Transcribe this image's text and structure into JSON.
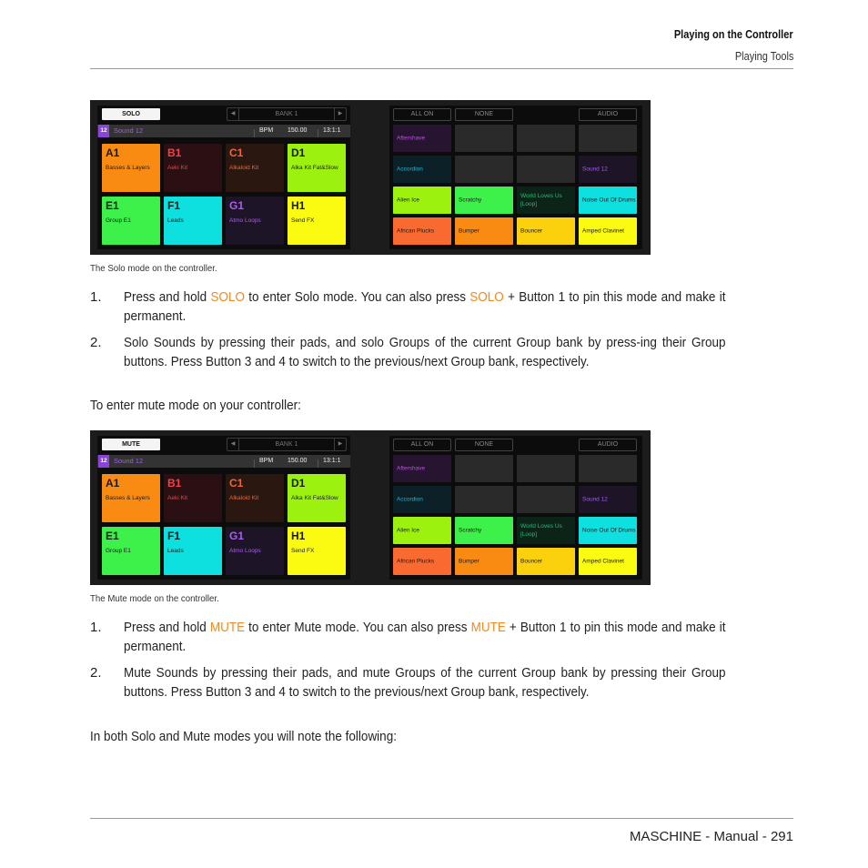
{
  "header": {
    "chapter": "Playing on the Controller",
    "section": "Playing Tools"
  },
  "figures": [
    {
      "mode_label": "SOLO",
      "caption": "The Solo mode on the controller.",
      "bank": {
        "label": "BANK 1",
        "prev_icon": "arrow-left-icon",
        "next_icon": "arrow-right-icon"
      },
      "status": {
        "sound_number": "12",
        "sound_name": "Sound 12",
        "bpm_label": "BPM",
        "bpm_value": "150.00",
        "position": "13:1:1"
      },
      "groups": [
        {
          "id": "A1",
          "name": "Basses & Layers",
          "bg": "#f98b13",
          "fg": "#1a1a1a"
        },
        {
          "id": "B1",
          "name": "Aeki Kit",
          "bg": "#2a1012",
          "fg": "#f0424a"
        },
        {
          "id": "C1",
          "name": "Alkaloid Kit",
          "bg": "#2a1710",
          "fg": "#f0643a"
        },
        {
          "id": "D1",
          "name": "Alka Kit Fat&Slow",
          "bg": "#9cf20e",
          "fg": "#1a1a1a"
        },
        {
          "id": "E1",
          "name": "Group E1",
          "bg": "#3ef14a",
          "fg": "#1a1a1a"
        },
        {
          "id": "F1",
          "name": "Leads",
          "bg": "#0ee0df",
          "fg": "#1a1a1a"
        },
        {
          "id": "G1",
          "name": "Atmo Loops",
          "bg": "#1e1428",
          "fg": "#a85ef0"
        },
        {
          "id": "H1",
          "name": "Send FX",
          "bg": "#fbfb12",
          "fg": "#1a1a1a"
        }
      ],
      "top_buttons": {
        "all_on": "ALL ON",
        "none": "NONE",
        "audio": "AUDIO"
      },
      "sounds": [
        {
          "name": "Aftershave",
          "bg": "#261430",
          "fg": "#c04ee8"
        },
        {
          "name": "",
          "bg": "#2a2a2a",
          "fg": "#888"
        },
        {
          "name": "",
          "bg": "#2a2a2a",
          "fg": "#888"
        },
        {
          "name": "",
          "bg": "#2a2a2a",
          "fg": "#888"
        },
        {
          "name": "Accordion",
          "bg": "#0c2028",
          "fg": "#18b8e0"
        },
        {
          "name": "",
          "bg": "#2a2a2a",
          "fg": "#888"
        },
        {
          "name": "",
          "bg": "#2a2a2a",
          "fg": "#888"
        },
        {
          "name": "Sound 12",
          "bg": "#1e1428",
          "fg": "#a25ee8"
        },
        {
          "name": "Alien Ice",
          "bg": "#9cf20e",
          "fg": "#1a1a1a"
        },
        {
          "name": "Scratchy",
          "bg": "#3ef14a",
          "fg": "#1a1a1a"
        },
        {
          "name": "World Loves Us [Loop]",
          "bg": "#0c2418",
          "fg": "#2cb878"
        },
        {
          "name": "Noise Out Of Drums",
          "bg": "#0ee0df",
          "fg": "#1a1a1a"
        },
        {
          "name": "African Plucks",
          "bg": "#f96a30",
          "fg": "#1a1a1a"
        },
        {
          "name": "Bumper",
          "bg": "#f98b13",
          "fg": "#1a1a1a"
        },
        {
          "name": "Bouncer",
          "bg": "#fbd10e",
          "fg": "#1a1a1a"
        },
        {
          "name": "Amped Clavinet",
          "bg": "#fbfb12",
          "fg": "#1a1a1a"
        }
      ]
    },
    {
      "mode_label": "MUTE",
      "caption": "The Mute mode on the controller.",
      "bank": {
        "label": "BANK 1",
        "prev_icon": "arrow-left-icon",
        "next_icon": "arrow-right-icon"
      },
      "status": {
        "sound_number": "12",
        "sound_name": "Sound 12",
        "bpm_label": "BPM",
        "bpm_value": "150.00",
        "position": "13:1:1"
      },
      "groups": [
        {
          "id": "A1",
          "name": "Basses & Layers",
          "bg": "#f98b13",
          "fg": "#1a1a1a"
        },
        {
          "id": "B1",
          "name": "Aeki Kit",
          "bg": "#2a1012",
          "fg": "#f0424a"
        },
        {
          "id": "C1",
          "name": "Alkaloid Kit",
          "bg": "#2a1710",
          "fg": "#f0643a"
        },
        {
          "id": "D1",
          "name": "Alka Kit Fat&Slow",
          "bg": "#9cf20e",
          "fg": "#1a1a1a"
        },
        {
          "id": "E1",
          "name": "Group E1",
          "bg": "#3ef14a",
          "fg": "#1a1a1a"
        },
        {
          "id": "F1",
          "name": "Leads",
          "bg": "#0ee0df",
          "fg": "#1a1a1a"
        },
        {
          "id": "G1",
          "name": "Atmo Loops",
          "bg": "#1e1428",
          "fg": "#a85ef0"
        },
        {
          "id": "H1",
          "name": "Send FX",
          "bg": "#fbfb12",
          "fg": "#1a1a1a"
        }
      ],
      "top_buttons": {
        "all_on": "ALL ON",
        "none": "NONE",
        "audio": "AUDIO"
      },
      "sounds": [
        {
          "name": "Aftershave",
          "bg": "#261430",
          "fg": "#c04ee8"
        },
        {
          "name": "",
          "bg": "#2a2a2a",
          "fg": "#888"
        },
        {
          "name": "",
          "bg": "#2a2a2a",
          "fg": "#888"
        },
        {
          "name": "",
          "bg": "#2a2a2a",
          "fg": "#888"
        },
        {
          "name": "Accordion",
          "bg": "#0c2028",
          "fg": "#18b8e0"
        },
        {
          "name": "",
          "bg": "#2a2a2a",
          "fg": "#888"
        },
        {
          "name": "",
          "bg": "#2a2a2a",
          "fg": "#888"
        },
        {
          "name": "Sound 12",
          "bg": "#1e1428",
          "fg": "#a25ee8"
        },
        {
          "name": "Alien Ice",
          "bg": "#9cf20e",
          "fg": "#1a1a1a"
        },
        {
          "name": "Scratchy",
          "bg": "#3ef14a",
          "fg": "#1a1a1a"
        },
        {
          "name": "World Loves Us [Loop]",
          "bg": "#0c2418",
          "fg": "#2cb878"
        },
        {
          "name": "Noise Out Of Drums",
          "bg": "#0ee0df",
          "fg": "#1a1a1a"
        },
        {
          "name": "African Plucks",
          "bg": "#f96a30",
          "fg": "#1a1a1a"
        },
        {
          "name": "Bumper",
          "bg": "#f98b13",
          "fg": "#1a1a1a"
        },
        {
          "name": "Bouncer",
          "bg": "#fbd10e",
          "fg": "#1a1a1a"
        },
        {
          "name": "Amped Clavinet",
          "bg": "#fbfb12",
          "fg": "#1a1a1a"
        }
      ]
    }
  ],
  "solo_steps": [
    {
      "num": "1.",
      "parts": [
        "Press and hold ",
        "SOLO",
        " to enter Solo mode. You can also press ",
        "SOLO",
        " + Button 1 to pin this mode and make it permanent."
      ]
    },
    {
      "num": "2.",
      "text": "Solo Sounds by pressing their pads, and solo Groups of the current Group bank by press-ing their Group buttons. Press Button 3 and 4 to switch to the previous/next Group bank, respectively."
    }
  ],
  "mute_intro": "To enter mute mode on your controller:",
  "mute_steps": [
    {
      "num": "1.",
      "parts": [
        "Press and hold ",
        "MUTE",
        " to enter Mute mode. You can also press ",
        "MUTE",
        " + Button 1 to pin this mode and make it permanent."
      ]
    },
    {
      "num": "2.",
      "text": "Mute Sounds by pressing their pads, and mute Groups of the current Group bank by pressing their Group buttons. Press Button 3 and 4 to switch to the previous/next Group bank, respectively."
    }
  ],
  "closing": "In both Solo and Mute modes you will note the following:",
  "footer": "MASCHINE - Manual - 291",
  "accent_color": "#f08a24"
}
